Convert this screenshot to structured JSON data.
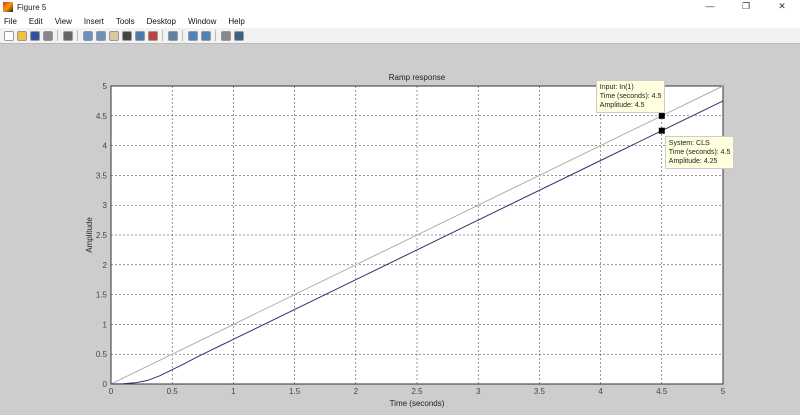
{
  "window": {
    "title": "Figure 5",
    "controls": [
      "—",
      "❐",
      "✕"
    ]
  },
  "menu": [
    "File",
    "Edit",
    "View",
    "Insert",
    "Tools",
    "Desktop",
    "Window",
    "Help"
  ],
  "toolbar": [
    {
      "icon": "new-figure-icon",
      "color": "#ffffff"
    },
    {
      "icon": "open-icon",
      "color": "#f0c040"
    },
    {
      "icon": "save-icon",
      "color": "#3050a0"
    },
    {
      "icon": "print-icon",
      "color": "#888888"
    },
    {
      "sep": true
    },
    {
      "icon": "edit-plot-arrow-icon",
      "color": "#666666"
    },
    {
      "sep": true
    },
    {
      "icon": "zoom-in-icon",
      "color": "#6a8fc0"
    },
    {
      "icon": "zoom-out-icon",
      "color": "#6a8fc0"
    },
    {
      "icon": "pan-hand-icon",
      "color": "#d8c8a0"
    },
    {
      "icon": "rotate-3d-icon",
      "color": "#444444"
    },
    {
      "icon": "data-cursor-icon",
      "color": "#4a7ab0"
    },
    {
      "icon": "brush-icon",
      "color": "#c04040"
    },
    {
      "sep": true
    },
    {
      "icon": "link-plot-icon",
      "color": "#6080a0"
    },
    {
      "sep": true
    },
    {
      "icon": "colorbar-icon",
      "color": "#5080c0"
    },
    {
      "icon": "legend-icon",
      "color": "#5080c0"
    },
    {
      "sep": true
    },
    {
      "icon": "hide-plot-tools-icon",
      "color": "#888888"
    },
    {
      "icon": "show-plot-tools-icon",
      "color": "#406080"
    }
  ],
  "chart_data": {
    "type": "line",
    "title": "Ramp response",
    "xlabel": "Time (seconds)",
    "ylabel": "Amplitude",
    "xlim": [
      0,
      5
    ],
    "ylim": [
      0,
      5
    ],
    "grid": true,
    "xticks": [
      "0",
      "0.5",
      "1",
      "1.5",
      "2",
      "2.5",
      "3",
      "3.5",
      "4",
      "4.5",
      "5"
    ],
    "yticks": [
      "0",
      "0.5",
      "1",
      "1.5",
      "2",
      "2.5",
      "3",
      "3.5",
      "4",
      "4.5",
      "5"
    ],
    "series": [
      {
        "name": "In(1)",
        "color": "#b0b0b0",
        "x": [
          0,
          5
        ],
        "y": [
          0,
          5
        ]
      },
      {
        "name": "CLS",
        "color": "#303070",
        "x": [
          0,
          0.1,
          0.2,
          0.3,
          0.4,
          0.5,
          0.6,
          0.7,
          0.8,
          0.9,
          1,
          2,
          3,
          4,
          5
        ],
        "y": [
          0,
          0.005,
          0.02,
          0.06,
          0.14,
          0.24,
          0.34,
          0.45,
          0.55,
          0.65,
          0.75,
          1.75,
          2.75,
          3.75,
          4.75
        ]
      }
    ],
    "datatips": [
      {
        "x": 4.5,
        "y": 4.5,
        "lines": [
          "Input: In(1)",
          "Time (seconds): 4.5",
          "Amplitude: 4.5"
        ]
      },
      {
        "x": 4.5,
        "y": 4.25,
        "lines": [
          "System: CLS",
          "Time (seconds): 4.5",
          "Amplitude: 4.25"
        ]
      }
    ]
  }
}
